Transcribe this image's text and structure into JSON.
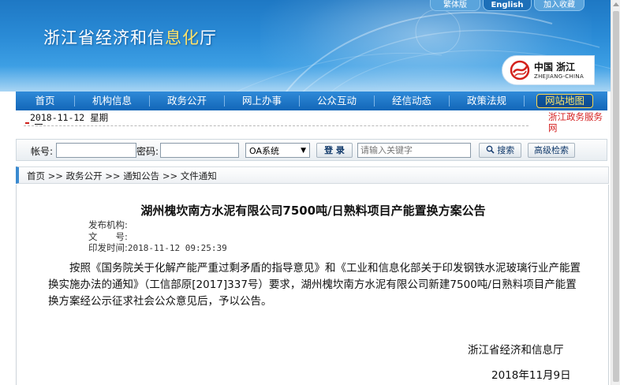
{
  "header": {
    "site_title_main": "浙江省经济和信",
    "site_title_accent": "息化",
    "site_title_end": "厅",
    "top_links": [
      "繁体版",
      "English",
      "加入收藏"
    ],
    "logo_cn": "中国 浙江",
    "logo_en": "ZHEJIANG-CHINA"
  },
  "nav": {
    "items": [
      "首页",
      "机构信息",
      "政务公开",
      "网上办事",
      "公众互动",
      "经信动态",
      "政策法规"
    ],
    "active_item": "网站地图"
  },
  "date_row": {
    "date": "2018-11-12",
    "weekday": "星期",
    "service_link": "浙江政务服务网"
  },
  "login": {
    "account_label": "帐号:",
    "password_label": "密码:",
    "system_select": "OA系统",
    "login_button": "登 录",
    "search_placeholder": "请输入关键字",
    "search_button": "搜索",
    "advanced_search_button": "高级检索"
  },
  "breadcrumb": {
    "items": [
      "首页",
      "政务公开",
      "通知公告",
      "文件通知"
    ],
    "separator": ">>"
  },
  "article": {
    "title": "湖州槐坎南方水泥有限公司7500吨/日熟料项目产能置换方案公告",
    "meta": {
      "publisher_label": "发布机构:",
      "publisher_value": "",
      "doc_no_label": "文　　号:",
      "doc_no_value": "",
      "print_time_label": "印发时间:",
      "print_time_value": "2018-11-12 09:25:39"
    },
    "body": "按照《国务院关于化解产能严重过剩矛盾的指导意见》和《工业和信息化部关于印发钢铁水泥玻璃行业产能置换实施办法的通知》（工信部原[2017]337号）要求，湖州槐坎南方水泥有限公司新建7500吨/日熟料项目产能置换方案经公示征求社会公众意见后，予以公告。",
    "signature_org": "浙江省经济和信息厅",
    "signature_date": "2018年11月9日"
  },
  "colors": {
    "header_blue": "#2a8bd6",
    "nav_blue": "#1266b8",
    "accent_yellow": "#ffe46a",
    "link_red": "#d41f1f"
  }
}
